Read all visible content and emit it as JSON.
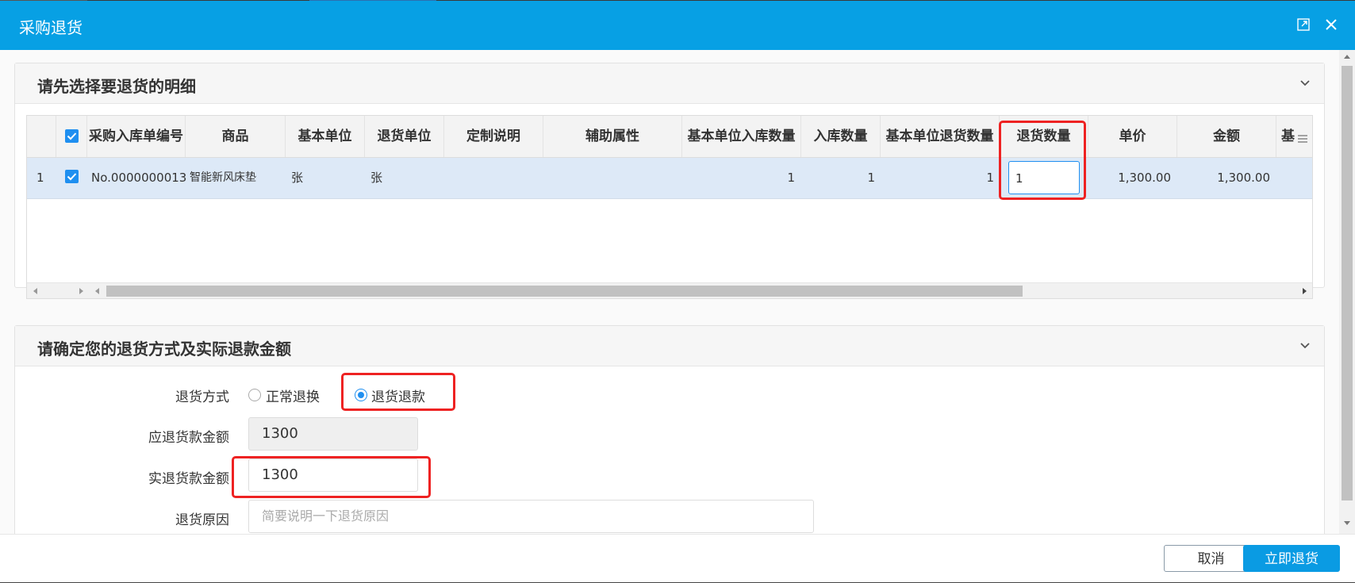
{
  "dialog": {
    "title": "采购退货"
  },
  "section1": {
    "title": "请先选择要退货的明细",
    "columns": [
      "采购入库单编号",
      "商品",
      "基本单位",
      "退货单位",
      "定制说明",
      "辅助属性",
      "基本单位入库数量",
      "入库数量",
      "基本单位退货数量",
      "退货数量",
      "单价",
      "金额",
      "基"
    ],
    "rows": [
      {
        "index": "1",
        "order_no": "No.0000000013",
        "product": "智能新风床垫",
        "base_unit": "张",
        "return_unit": "张",
        "custom_note": "",
        "aux_attr": "",
        "base_in_qty": "1",
        "in_qty": "1",
        "base_return_qty": "1",
        "return_qty": "1",
        "unit_price": "1,300.00",
        "amount": "1,300.00"
      }
    ]
  },
  "section2": {
    "title": "请确定您的退货方式及实际退款金额",
    "return_method_label": "退货方式",
    "options": {
      "normal_exchange": "正常退换",
      "refund": "退货退款"
    },
    "selected_option": "退货退款",
    "due_amount_label": "应退货款金额",
    "due_amount_value": "1300",
    "actual_amount_label": "实退货款金额",
    "actual_amount_value": "1300",
    "reason_label": "退货原因",
    "reason_placeholder": "简要说明一下退货原因"
  },
  "footer": {
    "cancel_label": "取消",
    "confirm_label": "立即退货"
  },
  "colors": {
    "accent": "#07a0e4",
    "highlight_box": "#ee2222",
    "selected_row": "#dde9f7"
  },
  "icons": {
    "maximize": "maximize-icon",
    "close": "close-icon",
    "collapse": "chevron-down-icon",
    "column_menu": "menu-lines-icon"
  }
}
